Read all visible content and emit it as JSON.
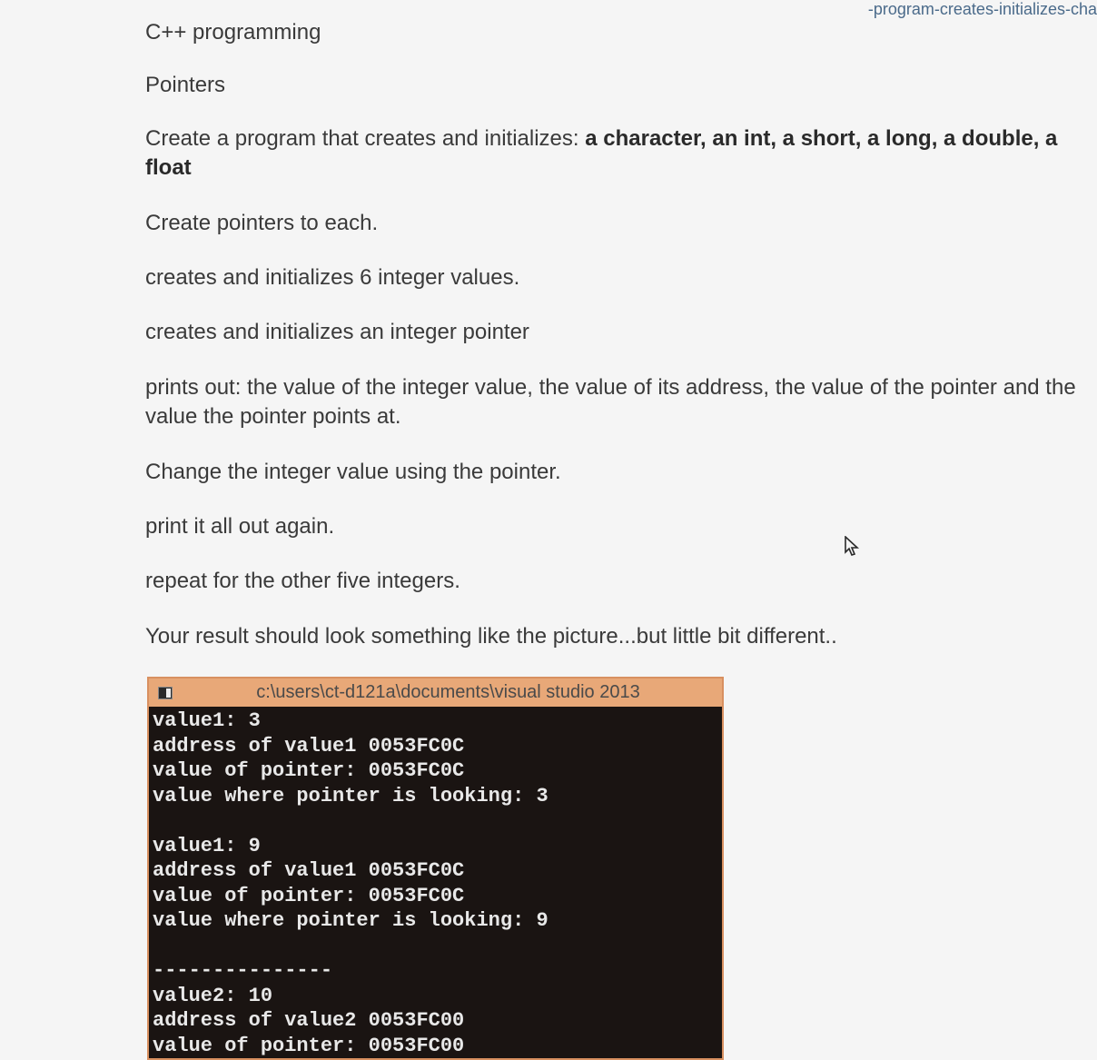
{
  "url_fragment": "-program-creates-initializes-cha",
  "question": {
    "line1": "C++ programming",
    "line2": "Pointers",
    "line3_pre": "Create a program that creates and initializes: ",
    "line3_bold": "a character, an int, a short, a long, a double, a float",
    "line4": "Create pointers to each.",
    "line5": "creates and initializes 6 integer values.",
    "line6": "creates and initializes an integer pointer",
    "line7": "prints out: the value of the integer value, the value of its address, the value of the pointer and the value the pointer points at.",
    "line8": "Change the integer value using the pointer.",
    "line9": "print it all out again.",
    "line10": "repeat for the other five integers.",
    "line11": "Your result should look something like the picture...but little bit different.."
  },
  "console": {
    "title": "c:\\users\\ct-d121a\\documents\\visual studio 2013",
    "lines": [
      "value1: 3",
      "address of value1 0053FC0C",
      "value of pointer: 0053FC0C",
      "value where pointer is looking: 3",
      "",
      "value1: 9",
      "address of value1 0053FC0C",
      "value of pointer: 0053FC0C",
      "value where pointer is looking: 9",
      "",
      "---------------",
      "value2: 10",
      "address of value2 0053FC00",
      "value of pointer: 0053FC00"
    ]
  }
}
